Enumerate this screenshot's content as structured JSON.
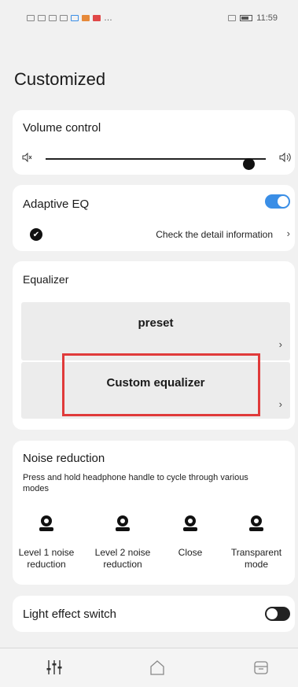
{
  "status_bar": {
    "left_text": "…",
    "right_time": "11:59"
  },
  "page": {
    "title": "Customized"
  },
  "volume": {
    "title": "Volume control",
    "level": 0.92,
    "icons": [
      "mute-icon",
      "speaker-icon"
    ]
  },
  "adaptive_eq": {
    "title": "Adaptive EQ",
    "enabled": true,
    "detail_link": "Check the detail information"
  },
  "equalizer": {
    "title": "Equalizer",
    "preset_label": "preset",
    "custom_label": "Custom equalizer"
  },
  "noise_reduction": {
    "title": "Noise reduction",
    "description": "Press and hold headphone handle to cycle through various modes",
    "modes": [
      {
        "label": "Level 1 noise reduction"
      },
      {
        "label": "Level 2 noise reduction"
      },
      {
        "label": "Close"
      },
      {
        "label": "Transparent mode"
      }
    ]
  },
  "light_effect": {
    "title": "Light effect switch",
    "enabled": false
  },
  "bottom_nav": {
    "items": [
      "equalizer-icon",
      "home-icon",
      "device-icon"
    ]
  },
  "colors": {
    "accent": "#3a8ee6",
    "highlight": "#e03a3a",
    "background": "#f1f1f1"
  }
}
